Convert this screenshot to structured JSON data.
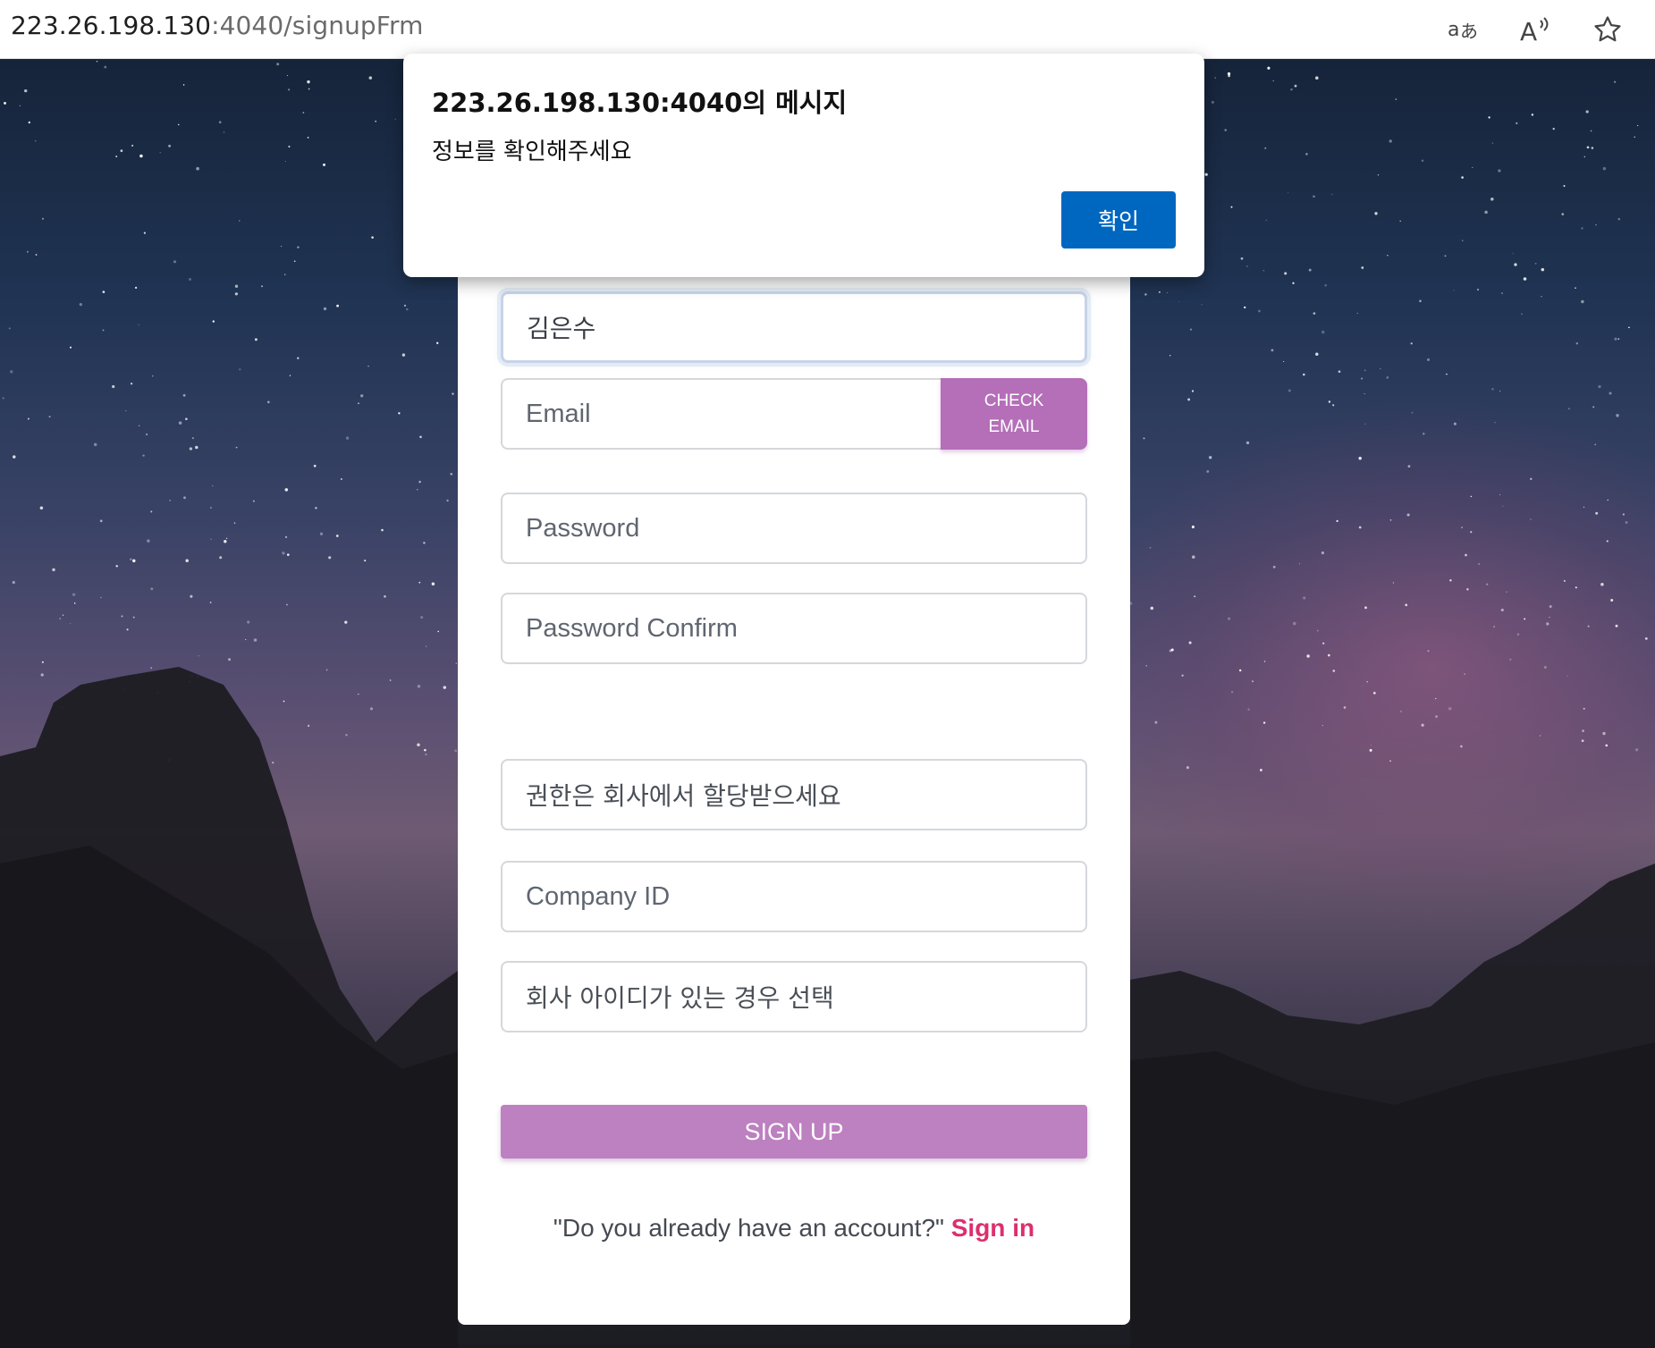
{
  "browser": {
    "url_host": "223.26.198.130",
    "url_path": ":4040/signupFrm",
    "icons": [
      "translate-icon",
      "read-aloud-icon",
      "favorite-star-icon"
    ]
  },
  "dialog": {
    "title": "223.26.198.130:4040의 메시지",
    "message": "정보를 확인해주세요",
    "ok_label": "확인"
  },
  "form": {
    "name_value": "김은수",
    "email_placeholder": "Email",
    "check_email_line1": "CHECK",
    "check_email_line2": "EMAIL",
    "password_placeholder": "Password",
    "password_confirm_placeholder": "Password Confirm",
    "role_text": "권한은 회사에서 할당받으세요",
    "company_id_placeholder": "Company ID",
    "company_select_text": "회사 아이디가 있는 경우 선택",
    "signup_label": "SIGN UP",
    "signin_prompt": "\"Do you already have an account?\"",
    "signin_link": "Sign in"
  },
  "colors": {
    "accent_purple": "#b46fb8",
    "signup_purple": "#bd80c0",
    "link_pink": "#dc2f6f",
    "dialog_button_blue": "#0067c0"
  }
}
